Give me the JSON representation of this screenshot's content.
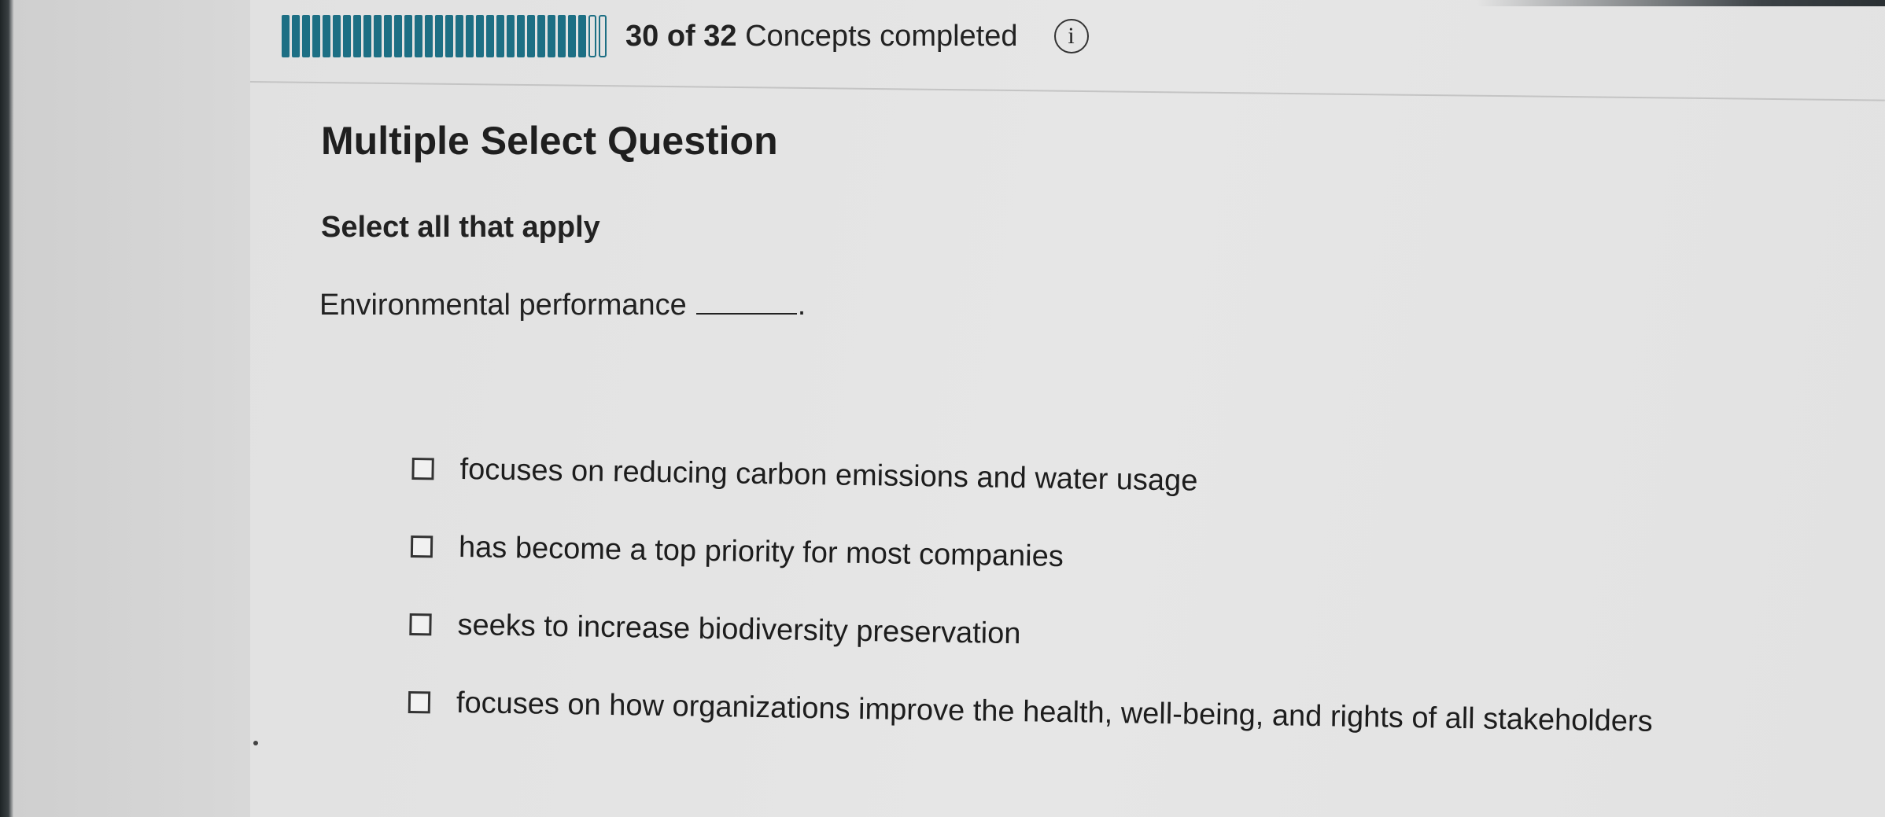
{
  "progress": {
    "completed": 30,
    "total": 32,
    "fraction": 0.9375,
    "text_count": "30 of 32",
    "text_suffix": " Concepts completed",
    "info_icon": "info-icon"
  },
  "question": {
    "type_title": "Multiple Select Question",
    "instruction": "Select all that apply",
    "prompt": "Environmental performance",
    "prompt_period": "."
  },
  "options": [
    {
      "label": "focuses on reducing carbon emissions and water usage",
      "checked": false
    },
    {
      "label": "has become a top priority for most companies",
      "checked": false
    },
    {
      "label": "seeks to increase biodiversity preservation",
      "checked": false
    },
    {
      "label": "focuses on how organizations improve the health, well-being, and rights of all stakeholders",
      "checked": false
    }
  ],
  "colors": {
    "progress_fill": "#1d6f84",
    "text": "#1d1d1d"
  }
}
